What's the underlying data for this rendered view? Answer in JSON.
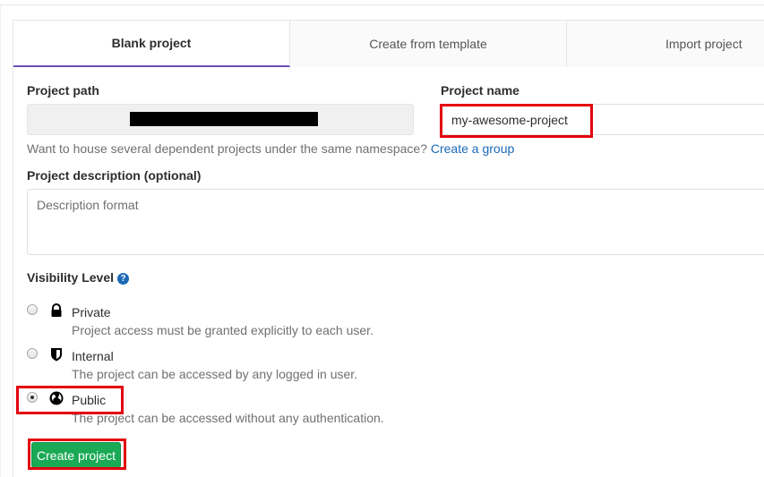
{
  "tabs": [
    {
      "label": "Blank project",
      "active": true
    },
    {
      "label": "Create from template",
      "active": false
    },
    {
      "label": "Import project",
      "active": false
    }
  ],
  "form": {
    "project_path_label": "Project path",
    "project_name_label": "Project name",
    "project_name_value": "my-awesome-project",
    "namespace_hint": "Want to house several dependent projects under the same namespace?",
    "create_group_link": "Create a group",
    "description_label": "Project description (optional)",
    "description_placeholder": "Description format",
    "visibility_label": "Visibility Level",
    "help_icon": "?"
  },
  "visibility": [
    {
      "title": "Private",
      "description": "Project access must be granted explicitly to each user.",
      "icon": "lock-icon",
      "checked": false
    },
    {
      "title": "Internal",
      "description": "The project can be accessed by any logged in user.",
      "icon": "shield-icon",
      "checked": false
    },
    {
      "title": "Public",
      "description": "The project can be accessed without any authentication.",
      "icon": "globe-icon",
      "checked": true
    }
  ],
  "actions": {
    "create_label": "Create project"
  },
  "colors": {
    "accent_tab": "#6b4fbb",
    "link": "#1b69b6",
    "success": "#1aaa55",
    "highlight": "#e3000f"
  }
}
